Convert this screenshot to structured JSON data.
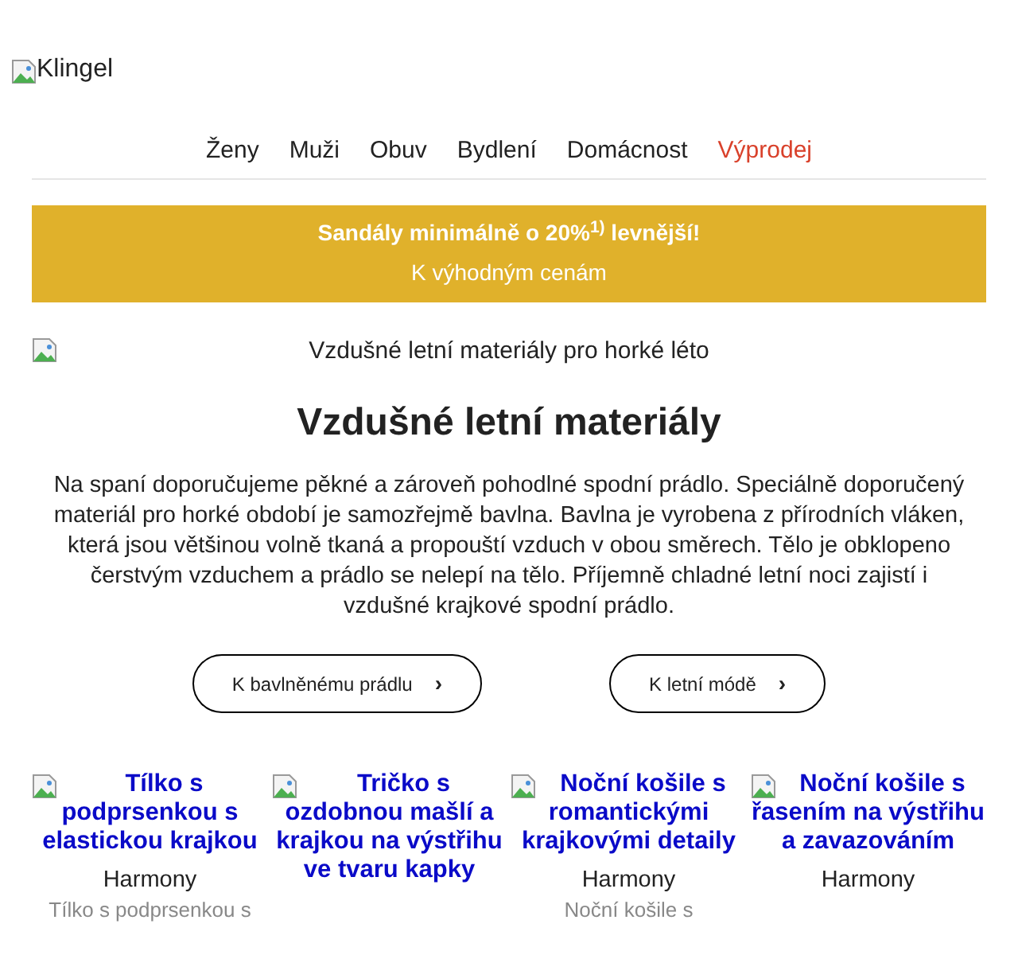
{
  "logo": {
    "alt": "Klingel"
  },
  "nav": [
    {
      "label": "Ženy",
      "kind": "normal"
    },
    {
      "label": "Muži",
      "kind": "normal"
    },
    {
      "label": "Obuv",
      "kind": "normal"
    },
    {
      "label": "Bydlení",
      "kind": "normal"
    },
    {
      "label": "Domácnost",
      "kind": "normal"
    },
    {
      "label": "Výprodej",
      "kind": "sale"
    }
  ],
  "banner": {
    "headline": "Sandály minimálně o 20%$^{1)}$ levnější!",
    "link": "K výhodným cenám"
  },
  "hero": {
    "image_alt": "Vzdušné letní materiály pro horké léto",
    "title": "Vzdušné letní materiály",
    "text": "Na spaní doporučujeme pěkné a zároveň pohodlné spodní prádlo. Speciálně doporučený materiál pro horké období je samozřejmě bavlna. Bavlna je vyrobena z přírodních vláken, která jsou většinou volně tkaná a propouští vzduch v obou směrech. Tělo je obklopeno čerstvým vzduchem a prádlo se nelepí na tělo. Příjemně chladné letní noci zajistí i vzdušné krajkové spodní prádlo."
  },
  "buttons": [
    {
      "label": "K bavlněnému prádlu",
      "icon": "›"
    },
    {
      "label": "K letní módě",
      "icon": "›"
    }
  ],
  "products": [
    {
      "title": "Tílko s podprsenkou s elastickou krajkou",
      "brand": "Harmony",
      "description": "Tílko s podprsenkou s"
    },
    {
      "title": "Tričko s ozdobnou mašlí a krajkou na výstřihu ve tvaru kapky"
    },
    {
      "title": "Noční košile s romantickými krajkovými detaily",
      "brand": "Harmony",
      "description": "Noční košile s"
    },
    {
      "title": "Noční košile s řasením na výstřihu a zavazováním",
      "brand": "Harmony"
    }
  ]
}
